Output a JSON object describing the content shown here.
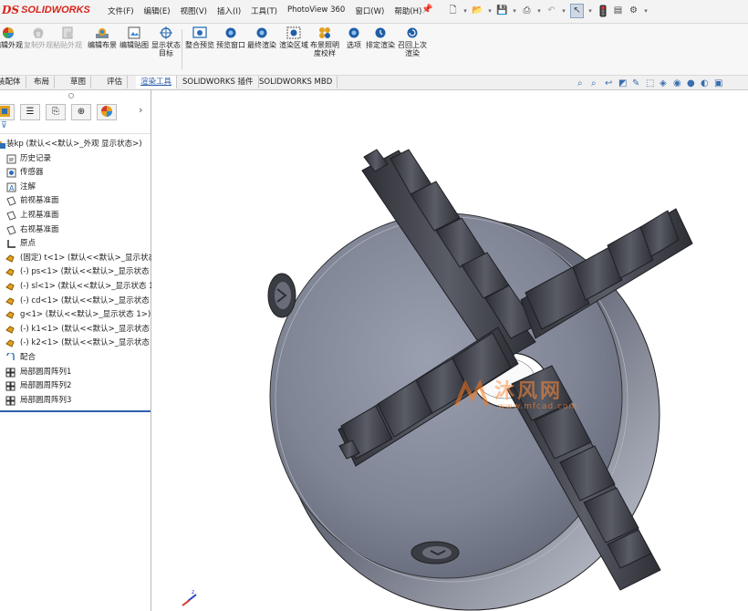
{
  "app": {
    "brand_prefix": "DS",
    "brand_name": "SOLIDWORKS"
  },
  "menu": [
    "文件(F)",
    "编辑(E)",
    "视图(V)",
    "插入(I)",
    "工具(T)",
    "PhotoView 360",
    "窗口(W)",
    "帮助(H)"
  ],
  "ribbon": {
    "buttons": [
      {
        "label": "编辑外观",
        "enabled": true
      },
      {
        "label": "复制外观",
        "enabled": false
      },
      {
        "label": "粘贴外观",
        "enabled": false
      },
      {
        "label": "编辑布景",
        "enabled": true
      },
      {
        "label": "编辑贴图",
        "enabled": true
      },
      {
        "label": "显示状态目标",
        "enabled": true
      },
      {
        "label": "整合预览",
        "enabled": true
      },
      {
        "label": "预览窗口",
        "enabled": true
      },
      {
        "label": "最终渲染",
        "enabled": true
      },
      {
        "label": "渲染区域",
        "enabled": true
      },
      {
        "label": "布景照明度校样",
        "enabled": true
      },
      {
        "label": "选项",
        "enabled": true
      },
      {
        "label": "排定渲染",
        "enabled": true
      },
      {
        "label": "召回上次渲染",
        "enabled": true
      }
    ]
  },
  "tabs": [
    {
      "label": "装配体",
      "active": false
    },
    {
      "label": "布局",
      "active": false
    },
    {
      "label": "草图",
      "active": false
    },
    {
      "label": "评估",
      "active": false
    },
    {
      "label": "渲染工具",
      "active": true
    },
    {
      "label": "SOLIDWORKS 插件",
      "active": false
    },
    {
      "label": "SOLIDWORKS MBD",
      "active": false
    }
  ],
  "feature_tree": {
    "root": "装kp  (默认<<默认>_外观 显示状态>)",
    "items": [
      {
        "label": "历史记录",
        "icon": "history-icon"
      },
      {
        "label": "传感器",
        "icon": "sensor-icon"
      },
      {
        "label": "注解",
        "icon": "annotation-icon"
      },
      {
        "label": "前视基准面",
        "icon": "plane-icon"
      },
      {
        "label": "上视基准面",
        "icon": "plane-icon"
      },
      {
        "label": "右视基准面",
        "icon": "plane-icon"
      },
      {
        "label": "原点",
        "icon": "origin-icon"
      },
      {
        "label": "(固定) t<1> (默认<<默认>_显示状态",
        "icon": "part-icon"
      },
      {
        "label": "(-) ps<1> (默认<<默认>_显示状态 1",
        "icon": "part-icon"
      },
      {
        "label": "(-) sl<1> (默认<<默认>_显示状态 1",
        "icon": "part-icon"
      },
      {
        "label": "(-) cd<1> (默认<<默认>_显示状态 1",
        "icon": "part-icon"
      },
      {
        "label": "g<1> (默认<<默认>_显示状态 1>)",
        "icon": "part-icon"
      },
      {
        "label": "(-) k1<1> (默认<<默认>_显示状态 1",
        "icon": "part-icon"
      },
      {
        "label": "(-) k2<1> (默认<<默认>_显示状态 1",
        "icon": "part-icon"
      },
      {
        "label": "配合",
        "icon": "mate-icon"
      },
      {
        "label": "局部圆周阵列1",
        "icon": "pattern-icon"
      },
      {
        "label": "局部圆周阵列2",
        "icon": "pattern-icon"
      },
      {
        "label": "局部圆周阵列3",
        "icon": "pattern-icon"
      }
    ]
  },
  "watermark": {
    "cn": "沐风网",
    "url": "www.mfcad.com"
  },
  "colors": {
    "brand": "#d9241b",
    "accent": "#2c5fb0",
    "body": "#6e7180",
    "jaw": "#3d3e46"
  }
}
